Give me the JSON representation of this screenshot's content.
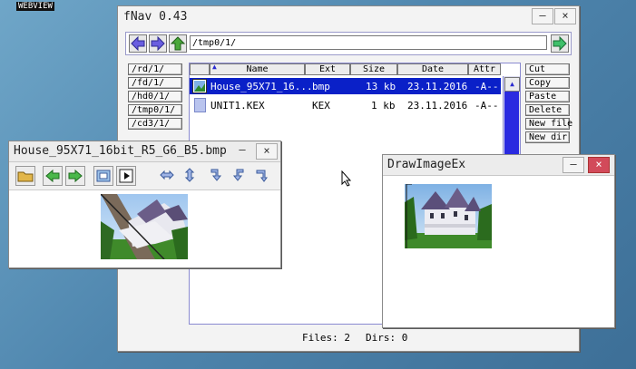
{
  "desktop": {
    "corner_label": "WEBVIEW"
  },
  "fnav": {
    "title": "fNav 0.43",
    "path": "/tmp0/1/",
    "drives": [
      "/rd/1/",
      "/fd/1/",
      "/hd0/1/",
      "/tmp0/1/",
      "/cd3/1/"
    ],
    "columns": {
      "name": "Name",
      "ext": "Ext",
      "size": "Size",
      "date": "Date",
      "attr": "Attr"
    },
    "files": [
      {
        "name": "House_95X71_16...",
        "ext": "bmp",
        "size": "13 kb",
        "date": "23.11.2016",
        "attr": "-A--",
        "icon": "image-file-icon",
        "selected": true
      },
      {
        "name": "UNIT1.KEX",
        "ext": "KEX",
        "size": "1 kb",
        "date": "23.11.2016",
        "attr": "-A--",
        "icon": "file-icon",
        "selected": false
      }
    ],
    "actions": [
      "Cut",
      "Copy",
      "Paste",
      "Delete",
      "New file",
      "New dir"
    ],
    "status": {
      "files": "Files: 2",
      "dirs": "Dirs: 0"
    },
    "colors": {
      "selection": "#0a20c8",
      "accent": "#4b4bd8"
    }
  },
  "viewer": {
    "title": "House_95X71_16bit_R5_G6_B5.bmp",
    "tools": [
      "open-folder-icon",
      "arrow-left-icon",
      "arrow-right-icon",
      "fit-screen-icon",
      "play-icon",
      "flip-horizontal-icon",
      "flip-vertical-icon",
      "rotate-cw-icon",
      "rotate-ccw-icon",
      "rotate-180-icon"
    ]
  },
  "drawimage": {
    "title": "DrawImageEx"
  },
  "window_buttons": {
    "minimize": "–",
    "close": "×"
  }
}
